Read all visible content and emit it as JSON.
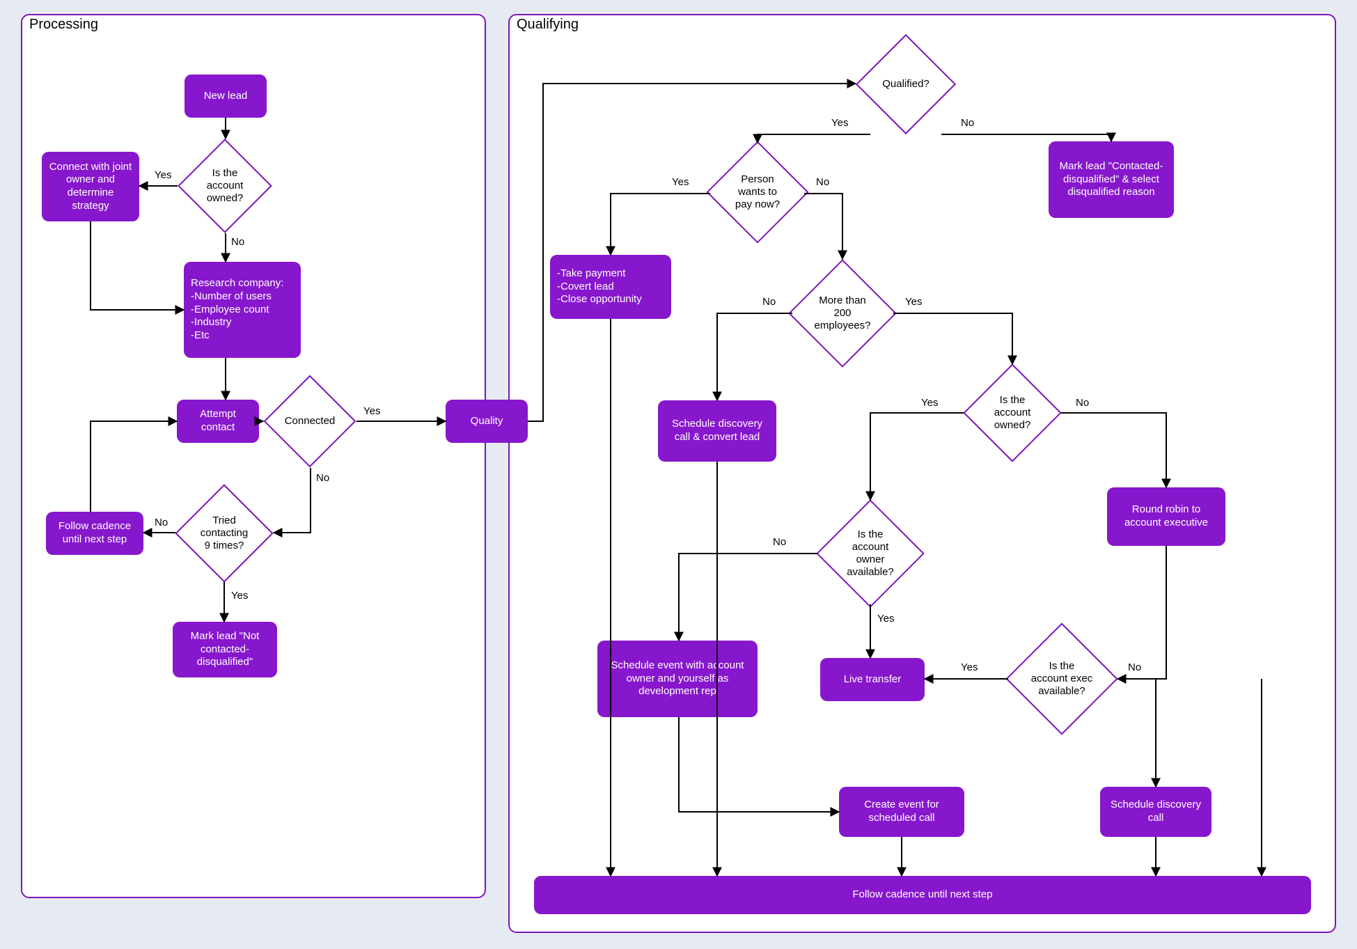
{
  "lanes": {
    "processing": "Processing",
    "qualifying": "Qualifying"
  },
  "edgeLabels": {
    "yes": "Yes",
    "no": "No"
  },
  "nodes": {
    "new_lead": "New lead",
    "account_owned": "Is the account owned?",
    "connect_joint": "Connect with joint owner and determine strategy",
    "research": "Research company:\n-Number of users\n-Employee count\n-Industry\n-Etc",
    "attempt_contact": "Attempt contact",
    "connected": "Connected",
    "tried9": "Tried contacting 9 times?",
    "follow_cadence": "Follow cadence until next step",
    "mark_not_contacted": "Mark lead \"Not contacted-disqualified\"",
    "quality": "Quality",
    "qualified": "Qualified?",
    "mark_contacted_dq": "Mark lead \"Contacted-disqualified\" & select disqualified reason",
    "pay_now": "Person wants to pay now?",
    "take_payment": "-Take payment\n-Covert lead\n-Close opportunity",
    "more200": "More than 200 employees?",
    "schedule_discovery_convert": "Schedule discovery call & convert lead",
    "acct_owned2": "Is the account owned?",
    "owner_available": "Is the account owner available?",
    "round_robin": "Round robin to account executive",
    "schedule_event_dev": "Schedule event with account owner and yourself as development rep",
    "live_transfer": "Live transfer",
    "exec_available": "Is the account exec available?",
    "create_event": "Create event for scheduled call",
    "schedule_discovery": "Schedule discovery call",
    "follow_cadence2": "Follow cadence until next step"
  }
}
